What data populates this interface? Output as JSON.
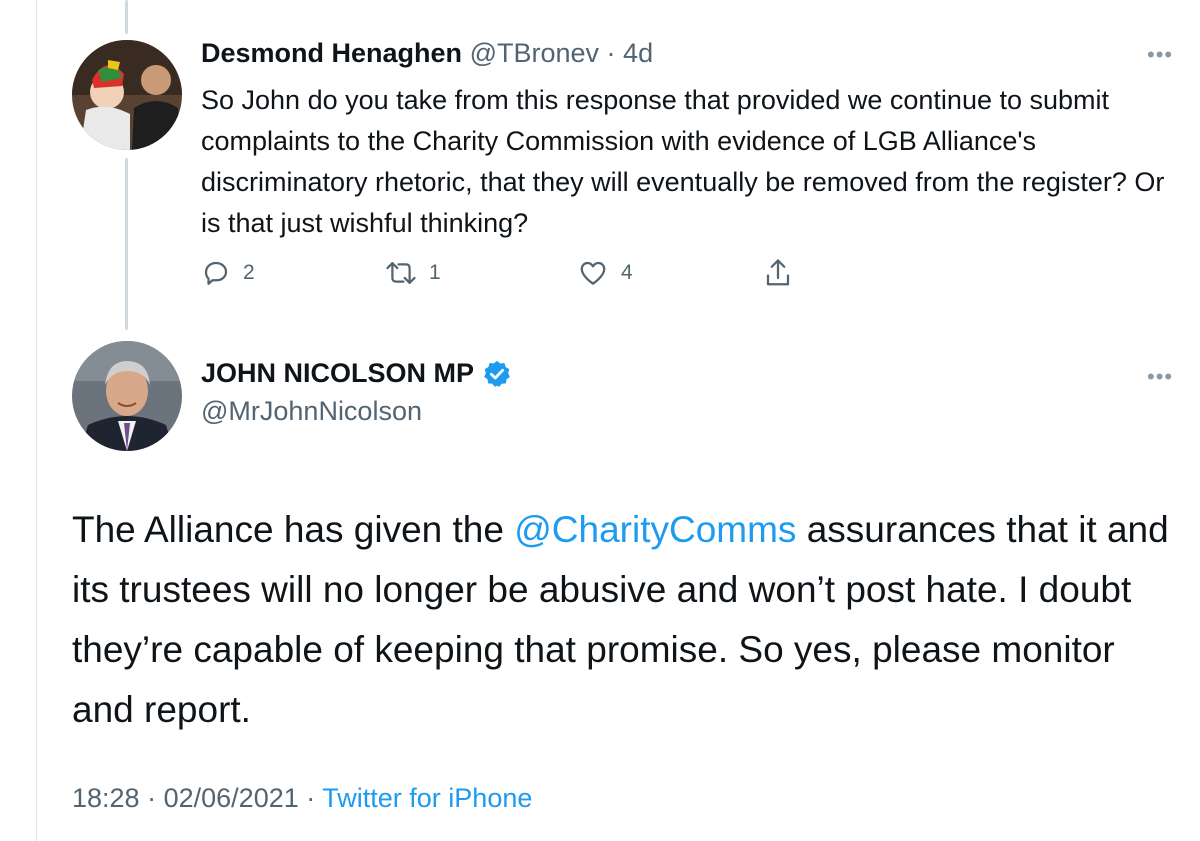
{
  "reply_tweet": {
    "author_name": "Desmond Henaghen",
    "handle": "@TBronev",
    "separator": "·",
    "age": "4d",
    "text": "So John do you take from this response that provided we continue to submit complaints to the Charity Commission with evidence of LGB Alliance's discriminatory rhetoric, that they will eventually be removed from the register? Or is that just wishful thinking?",
    "reply_count": "2",
    "retweet_count": "1",
    "like_count": "4",
    "more_icon": "more-horizontal-icon"
  },
  "main_tweet": {
    "author_name": "JOHN NICOLSON MP",
    "handle": "@MrJohnNicolson",
    "verified": true,
    "text_before_mention": "The Alliance has given the ",
    "mention": "@CharityComms",
    "text_after_mention": " assurances that it and its trustees will no longer be abusive and won’t post hate. I doubt they’re capable of keeping that promise. So yes, please monitor and report.",
    "time": "18:28",
    "separator": "·",
    "date": "02/06/2021",
    "source": "Twitter for iPhone",
    "more_icon": "more-horizontal-icon"
  },
  "colors": {
    "link": "#1d9bf0",
    "muted_text": "#536471",
    "text": "#0f1419",
    "thread_line": "#cfd9de",
    "verified": "#1d9bf0"
  }
}
